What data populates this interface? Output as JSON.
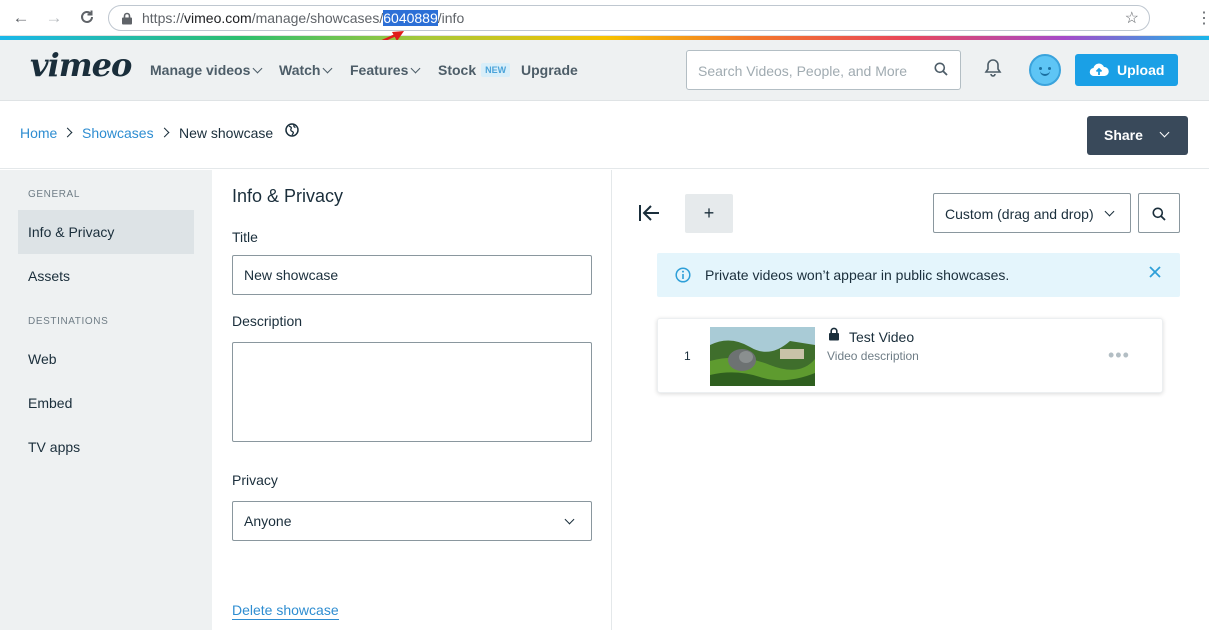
{
  "browser": {
    "url_prefix": "https://",
    "url_domain": "vimeo.com",
    "url_path": "/manage/showcases/",
    "url_highlight": "6040889",
    "url_suffix": "/info"
  },
  "header": {
    "logo": "vimeo",
    "nav": [
      {
        "label": "Manage videos",
        "has_menu": true
      },
      {
        "label": "Watch",
        "has_menu": true
      },
      {
        "label": "Features",
        "has_menu": true
      },
      {
        "label": "Stock",
        "badge": "NEW"
      },
      {
        "label": "Upgrade"
      }
    ],
    "search_placeholder": "Search Videos, People, and More",
    "upload_label": "Upload",
    "colors": {
      "upload": "#1aa0e6",
      "accent_link": "#2e8dd1"
    }
  },
  "breadcrumb": {
    "items": [
      "Home",
      "Showcases",
      "New showcase"
    ],
    "share_label": "Share"
  },
  "sidebar": {
    "sections": [
      {
        "heading": "GENERAL",
        "items": [
          "Info & Privacy",
          "Assets"
        ]
      },
      {
        "heading": "DESTINATIONS",
        "items": [
          "Web",
          "Embed",
          "TV apps"
        ]
      }
    ],
    "active_item": "Info & Privacy"
  },
  "form": {
    "title": "Info & Privacy",
    "title_label": "Title",
    "title_value": "New showcase",
    "description_label": "Description",
    "description_value": "",
    "privacy_label": "Privacy",
    "privacy_value": "Anyone",
    "delete_label": "Delete showcase"
  },
  "panel": {
    "add_label": "+",
    "sort_value": "Custom (drag and drop)",
    "notice": "Private videos won’t appear in public showcases.",
    "videos": [
      {
        "index": "1",
        "title": "Test Video",
        "description": "Video description",
        "private": true
      }
    ]
  }
}
